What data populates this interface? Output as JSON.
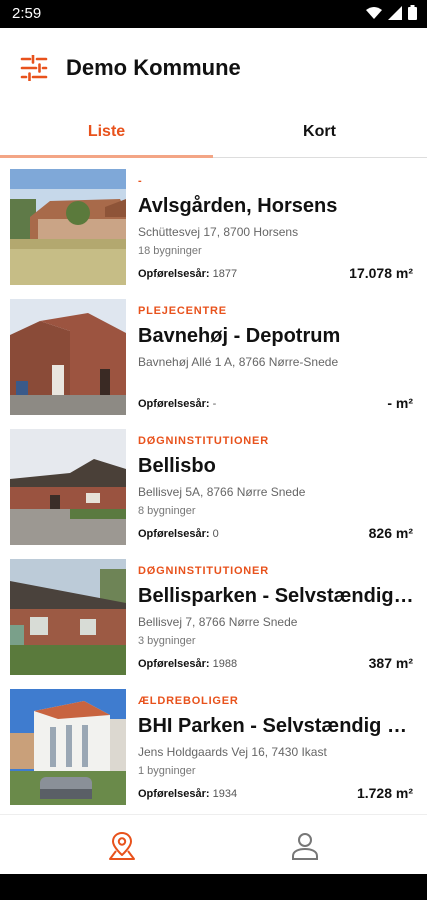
{
  "status": {
    "time": "2:59"
  },
  "header": {
    "title": "Demo Kommune",
    "filter_icon": "sliders-icon"
  },
  "tabs": [
    {
      "label": "Liste",
      "active": true
    },
    {
      "label": "Kort",
      "active": false
    }
  ],
  "colors": {
    "accent": "#e8521c",
    "text": "#111111",
    "muted": "#666666"
  },
  "properties": [
    {
      "category": "-",
      "name": "Avlsgården, Horsens",
      "address": "Schüttesvej 17, 8700 Horsens",
      "buildings": "18 bygninger",
      "year_label": "Opførelsesår:",
      "year": "1877",
      "area": "17.078 m²"
    },
    {
      "category": "PLEJECENTRE",
      "name": "Bavnehøj - Depotrum",
      "address": "Bavnehøj Allé 1 A, 8766 Nørre-Snede",
      "buildings": "",
      "year_label": "Opførelsesår:",
      "year": "-",
      "area": "- m²"
    },
    {
      "category": "DØGNINSTITUTIONER",
      "name": "Bellisbo",
      "address": "Bellisvej 5A, 8766 Nørre Snede",
      "buildings": "8 bygninger",
      "year_label": "Opførelsesår:",
      "year": "0",
      "area": "826 m²"
    },
    {
      "category": "DØGNINSTITUTIONER",
      "name": "Bellisparken - Selvstændig boligenhed",
      "address": "Bellisvej 7, 8766 Nørre Snede",
      "buildings": "3 bygninger",
      "year_label": "Opførelsesår:",
      "year": "1988",
      "area": "387 m²"
    },
    {
      "category": "ÆLDREBOLIGER",
      "name": "BHI Parken - Selvstændig boligenhed",
      "address": "Jens Holdgaards Vej 16, 7430 Ikast",
      "buildings": "1 bygninger",
      "year_label": "Opførelsesår:",
      "year": "1934",
      "area": "1.728 m²"
    }
  ],
  "bottom_nav": [
    {
      "icon": "map-pin-icon",
      "active": true
    },
    {
      "icon": "person-icon",
      "active": false
    }
  ]
}
